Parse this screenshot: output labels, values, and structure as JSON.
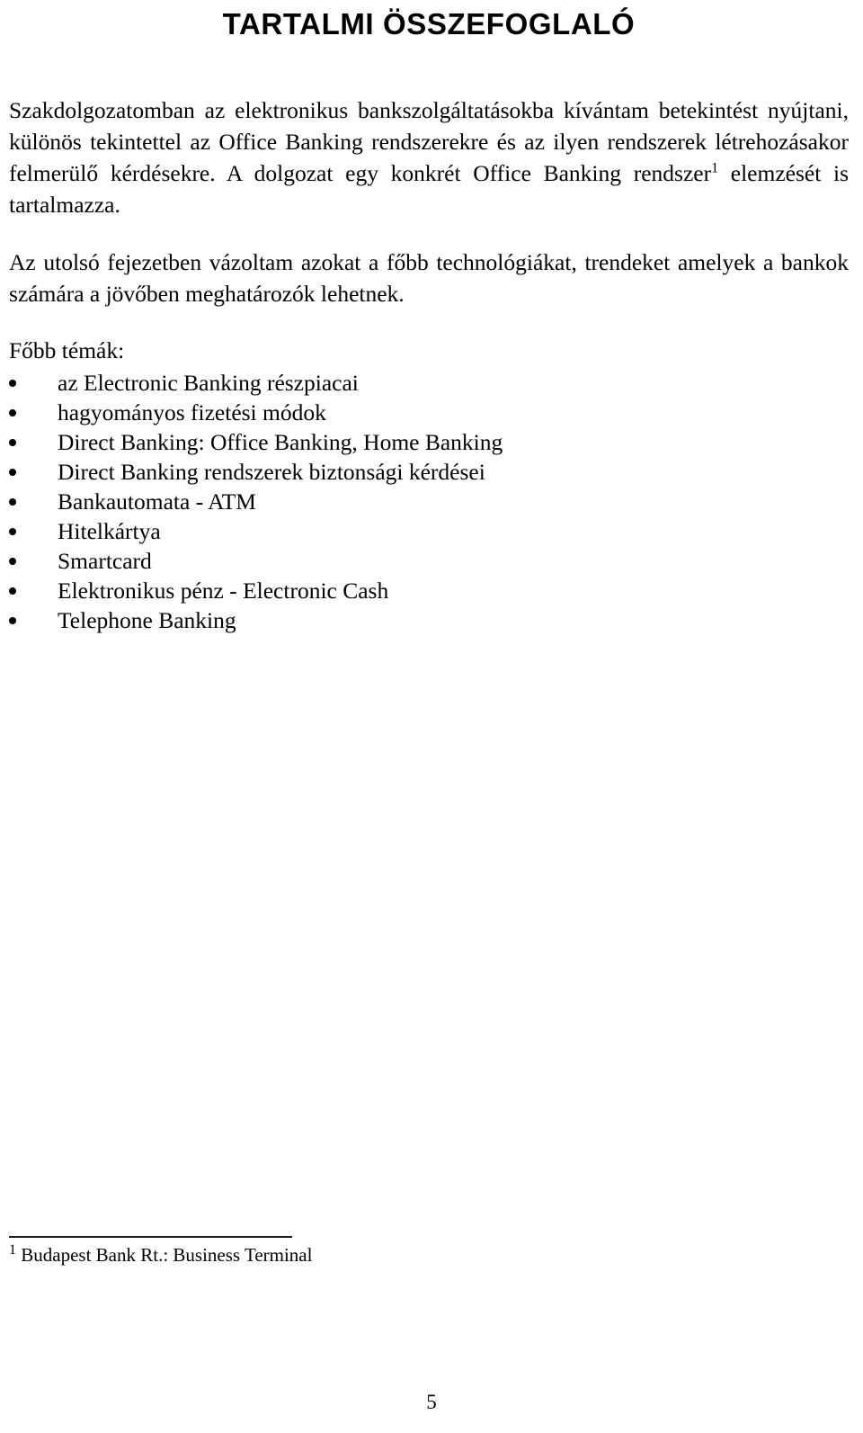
{
  "document": {
    "title": "TARTALMI ÖSSZEFOGLALÓ",
    "paragraphs": {
      "p1_before_marker": "Szakdolgozatomban az elektronikus bankszolgáltatásokba kívántam betekintést nyújtani, különös tekintettel az Office Banking rendszerekre és az ilyen rendszerek létrehozásakor felmerülő kérdésekre. A dolgozat egy konkrét Office Banking rendszer",
      "p1_footnote_marker": "1",
      "p1_after_marker": " elemzését is tartalmazza.",
      "p2": "Az utolsó fejezetben vázoltam azokat a főbb technológiákat, trendeket amelyek a bankok számára a jövőben meghatározók lehetnek."
    },
    "topics_label": "Főbb témák:",
    "topics": [
      "az Electronic Banking részpiacai",
      "hagyományos fizetési módok",
      "Direct Banking: Office Banking, Home Banking",
      "Direct Banking rendszerek biztonsági kérdései",
      "Bankautomata - ATM",
      "Hitelkártya",
      "Smartcard",
      "Elektronikus pénz - Electronic Cash",
      "Telephone Banking"
    ],
    "footnote": {
      "marker": "1",
      "text": "Budapest Bank Rt.: Business Terminal"
    },
    "page_number": "5"
  }
}
